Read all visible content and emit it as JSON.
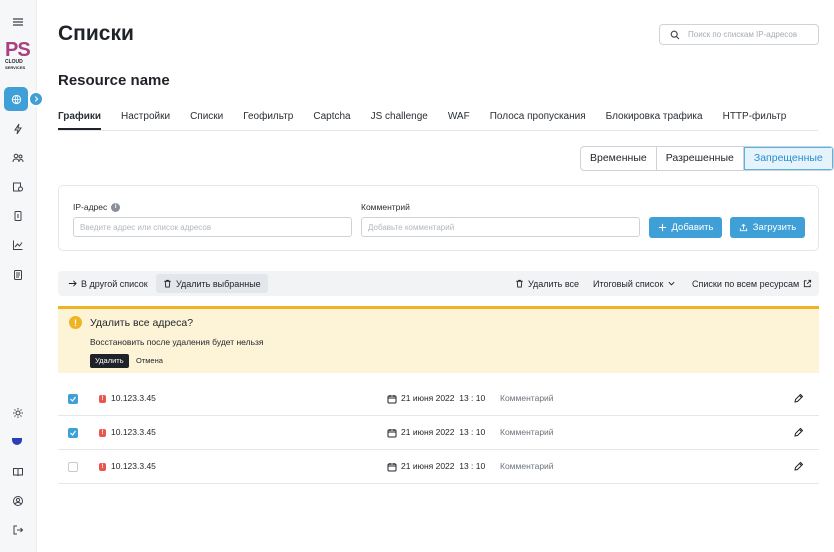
{
  "sidebar": {
    "logo": {
      "mark": "PS",
      "line1": "CLOUD",
      "line2": "SERVICES"
    },
    "icons": [
      "menu-icon",
      "globe-icon",
      "lightning-icon",
      "users-icon",
      "shield-doc-icon",
      "doc-icon",
      "chart-icon",
      "file-icon",
      "sun-icon",
      "flag-icon",
      "book-icon",
      "account-icon",
      "logout-icon"
    ]
  },
  "header": {
    "title": "Списки",
    "search_placeholder": "Поиск по спискам IP-адресов",
    "resource_name": "Resource name"
  },
  "tabs": [
    "Графики",
    "Настройки",
    "Списки",
    "Геофильтр",
    "Captcha",
    "JS challenge",
    "WAF",
    "Полоса пропускания",
    "Блокировка трафика",
    "HTTP-фильтр"
  ],
  "list_types": [
    "Временные",
    "Разрешенные",
    "Запрещенные"
  ],
  "form": {
    "ip_label": "IP-адрес",
    "ip_placeholder": "Введите адрес или список адресов",
    "comment_label": "Комментрий",
    "comment_placeholder": "Добавьте комментарий",
    "add_label": "Добавить",
    "upload_label": "Загрузить"
  },
  "toolbar": {
    "move": "В другой список",
    "delete_selected": "Удалить выбранные",
    "delete_all": "Удалить все",
    "summary": "Итоговый список",
    "all_resources": "Списки по всем ресурсам"
  },
  "alert": {
    "title": "Удалить все адреса?",
    "text": "Восстановить после удаления будет нельзя",
    "confirm": "Удалить",
    "cancel": "Отмена"
  },
  "rows": [
    {
      "checked": true,
      "ip": "10.123.3.45",
      "date": "21 июня 2022  13 : 10",
      "comment": "Комментарий"
    },
    {
      "checked": true,
      "ip": "10.123.3.45",
      "date": "21 июня 2022  13 : 10",
      "comment": "Комментарий"
    },
    {
      "checked": false,
      "ip": "10.123.3.45",
      "date": "21 июня 2022  13 : 10",
      "comment": "Комментарий"
    }
  ],
  "colors": {
    "accent": "#3fa0d8",
    "brand": "#a8417f",
    "warning": "#f0b323",
    "danger": "#e8574f"
  }
}
